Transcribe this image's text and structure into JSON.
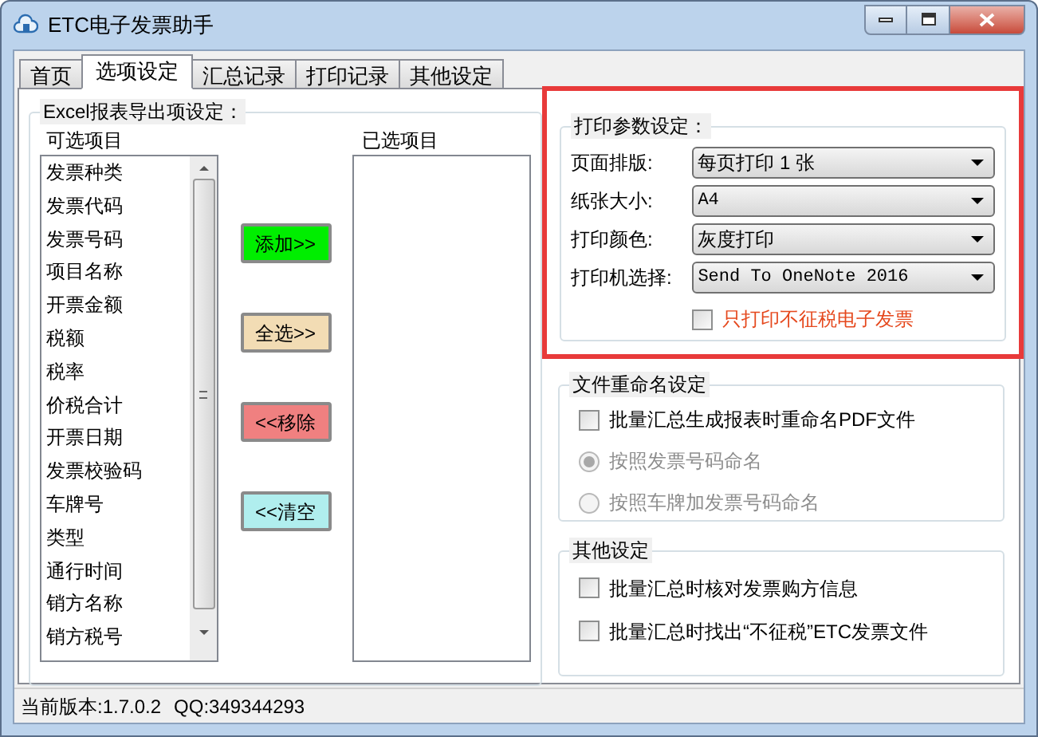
{
  "window": {
    "title": "ETC电子发票助手"
  },
  "tabs": [
    {
      "label": "首页",
      "selected": false
    },
    {
      "label": "选项设定",
      "selected": true
    },
    {
      "label": "汇总记录",
      "selected": false
    },
    {
      "label": "打印记录",
      "selected": false
    },
    {
      "label": "其他设定",
      "selected": false
    }
  ],
  "excel_export": {
    "legend": "Excel报表导出项设定：",
    "available": {
      "label": "可选项目",
      "items": [
        "发票种类",
        "发票代码",
        "发票号码",
        "项目名称",
        "开票金额",
        "税额",
        "税率",
        "价税合计",
        "开票日期",
        "发票校验码",
        "车牌号",
        "类型",
        "通行时间",
        "销方名称",
        "销方税号"
      ]
    },
    "selected": {
      "label": "已选项目"
    },
    "buttons": [
      {
        "label": "添加>>",
        "color": "#00ee00"
      },
      {
        "label": "全选>>",
        "color": "#f2dcb4"
      },
      {
        "label": "<<移除",
        "color": "#f08080"
      },
      {
        "label": "<<清空",
        "color": "#b0eeee"
      }
    ]
  },
  "print_settings": {
    "legend": "打印参数设定：",
    "highlighted": true,
    "fields": [
      {
        "label": "页面排版:",
        "value": "每页打印 1 张"
      },
      {
        "label": "纸张大小:",
        "value": "A4"
      },
      {
        "label": "打印颜色:",
        "value": "灰度打印"
      },
      {
        "label": "打印机选择:",
        "value": "Send To OneNote 2016"
      }
    ],
    "checkbox": {
      "label": "只打印不征税电子发票",
      "checked": false
    }
  },
  "rename_settings": {
    "legend": "文件重命名设定",
    "checkbox": {
      "label": "批量汇总生成报表时重命名PDF文件",
      "checked": false
    },
    "radios": [
      {
        "label": "按照发票号码命名",
        "selected": true,
        "disabled": true
      },
      {
        "label": "按照车牌加发票号码命名",
        "selected": false,
        "disabled": true
      }
    ]
  },
  "other_settings": {
    "legend": "其他设定",
    "checkboxes": [
      {
        "label": "批量汇总时核对发票购方信息",
        "checked": false
      },
      {
        "label": "批量汇总时找出“不征税”ETC发票文件",
        "checked": false
      }
    ]
  },
  "status_bar": [
    "当前版本:1.7.0.2",
    "QQ:349344293"
  ]
}
